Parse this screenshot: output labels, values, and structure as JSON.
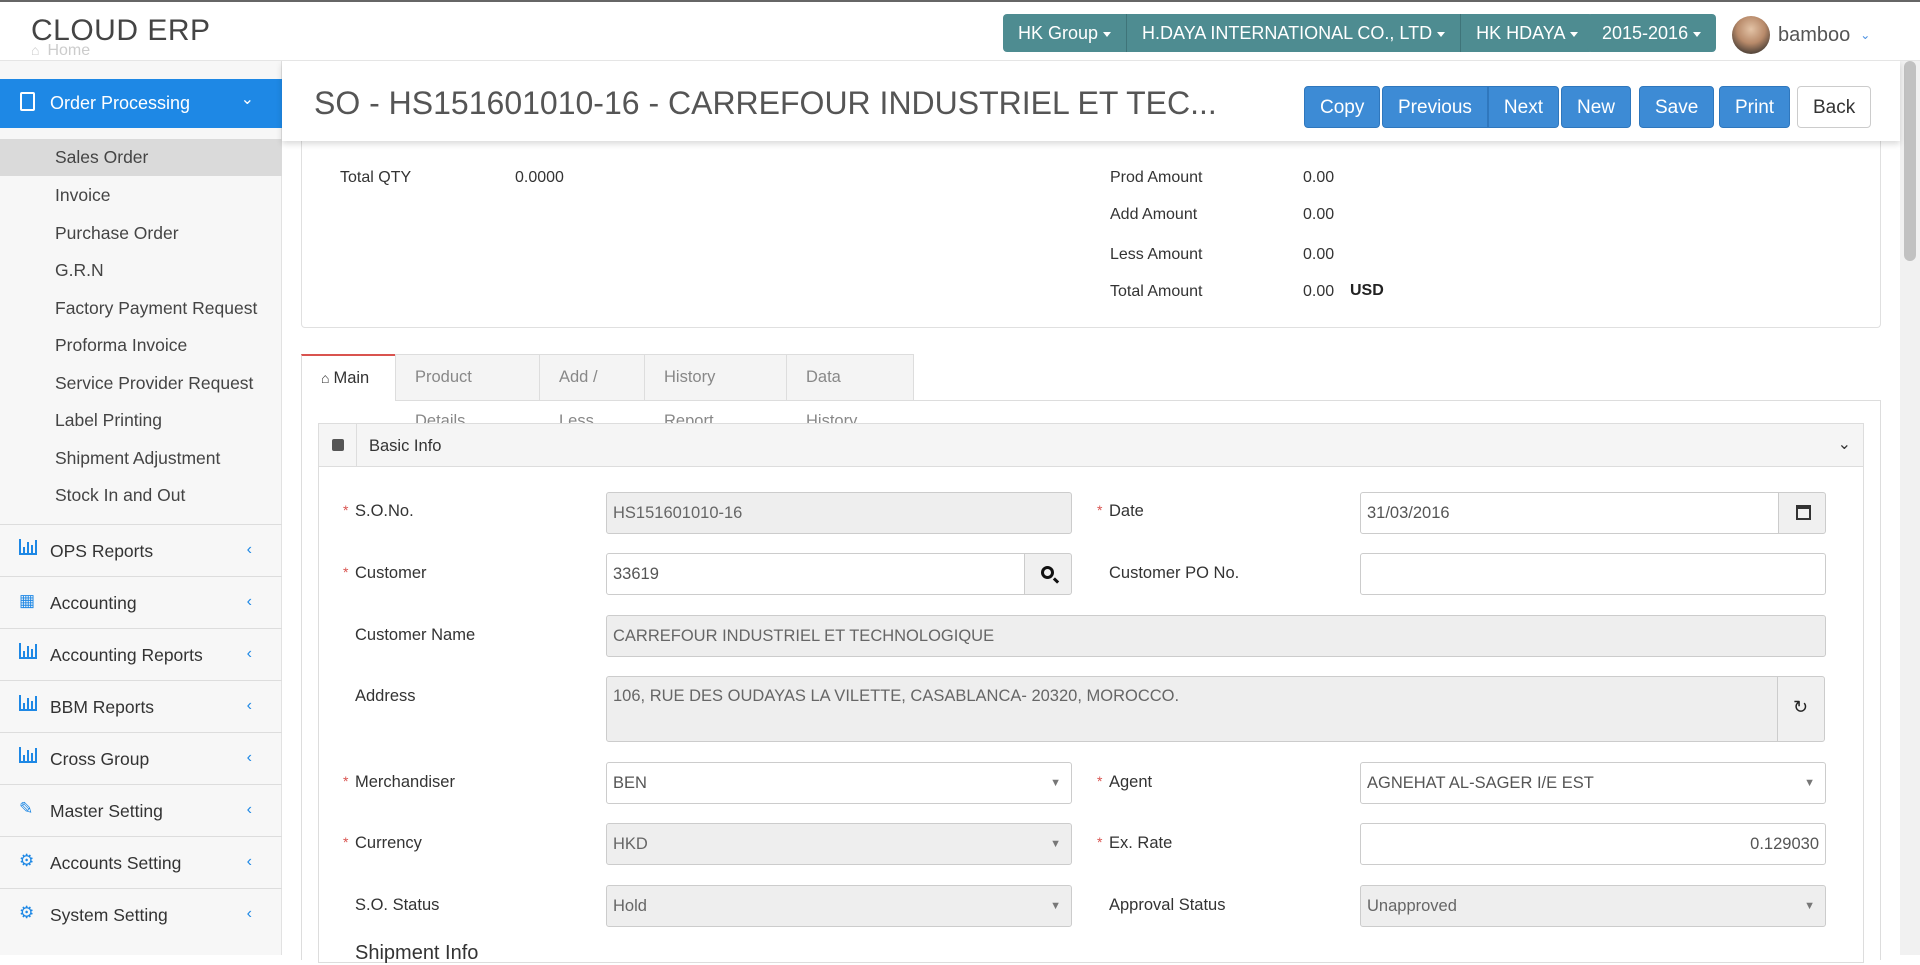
{
  "app": {
    "logo": "CLOUD ERP",
    "home_ghost": "Home"
  },
  "header": {
    "group": "HK Group",
    "company": "H.DAYA INTERNATIONAL CO., LTD",
    "branch": "HK HDAYA",
    "period": "2015-2016",
    "username": "bamboo"
  },
  "sidebar": {
    "active_section": "Order Processing",
    "sub_items": [
      "Sales Order",
      "Invoice",
      "Purchase Order",
      "G.R.N",
      "Factory Payment Request",
      "Proforma Invoice",
      "Service Provider Request",
      "Label Printing",
      "Shipment Adjustment",
      "Stock In and Out"
    ],
    "selected_sub_item": "Sales Order",
    "sections": [
      {
        "label": "OPS Reports",
        "icon": "bar-chart-icon"
      },
      {
        "label": "Accounting",
        "icon": "table-grid-icon"
      },
      {
        "label": "Accounting Reports",
        "icon": "bar-chart-icon"
      },
      {
        "label": "BBM Reports",
        "icon": "bar-chart-icon"
      },
      {
        "label": "Cross Group",
        "icon": "bar-chart-icon"
      },
      {
        "label": "Master Setting",
        "icon": "edit-icon"
      },
      {
        "label": "Accounts Setting",
        "icon": "gear-icon"
      },
      {
        "label": "System Setting",
        "icon": "gear-icon"
      }
    ]
  },
  "toolbar": {
    "title": "SO - HS151601010-16 - CARREFOUR INDUSTRIEL ET TEC...",
    "copy": "Copy",
    "previous": "Previous",
    "next": "Next",
    "new": "New",
    "save": "Save",
    "print": "Print",
    "back": "Back"
  },
  "summary": {
    "total_qty_label": "Total QTY",
    "total_qty": "0.0000",
    "prod_amount_label": "Prod Amount",
    "prod_amount": "0.00",
    "add_amount_label": "Add Amount",
    "add_amount": "0.00",
    "less_amount_label": "Less Amount",
    "less_amount": "0.00",
    "total_amount_label": "Total Amount",
    "total_amount": "0.00",
    "currency_unit": "USD"
  },
  "tabs": [
    "Main",
    "Product Details",
    "Add / Less",
    "History Report",
    "Data History"
  ],
  "panel": {
    "title": "Basic Info"
  },
  "form": {
    "so_no_label": "S.O.No.",
    "so_no": "HS151601010-16",
    "date_label": "Date",
    "date": "31/03/2016",
    "customer_label": "Customer",
    "customer": "33619",
    "customer_po_label": "Customer PO No.",
    "customer_po": "",
    "customer_name_label": "Customer Name",
    "customer_name": "CARREFOUR INDUSTRIEL ET TECHNOLOGIQUE",
    "address_label": "Address",
    "address": "106, RUE DES OUDAYAS LA VILETTE, CASABLANCA- 20320, MOROCCO.",
    "merchandiser_label": "Merchandiser",
    "merchandiser": "BEN",
    "agent_label": "Agent",
    "agent": "AGNEHAT AL-SAGER I/E EST",
    "currency_label": "Currency",
    "currency": "HKD",
    "ex_rate_label": "Ex. Rate",
    "ex_rate": "0.129030",
    "so_status_label": "S.O. Status",
    "so_status": "Hold",
    "approval_status_label": "Approval Status",
    "approval_status": "Unapproved",
    "next_section": "Shipment Info"
  }
}
